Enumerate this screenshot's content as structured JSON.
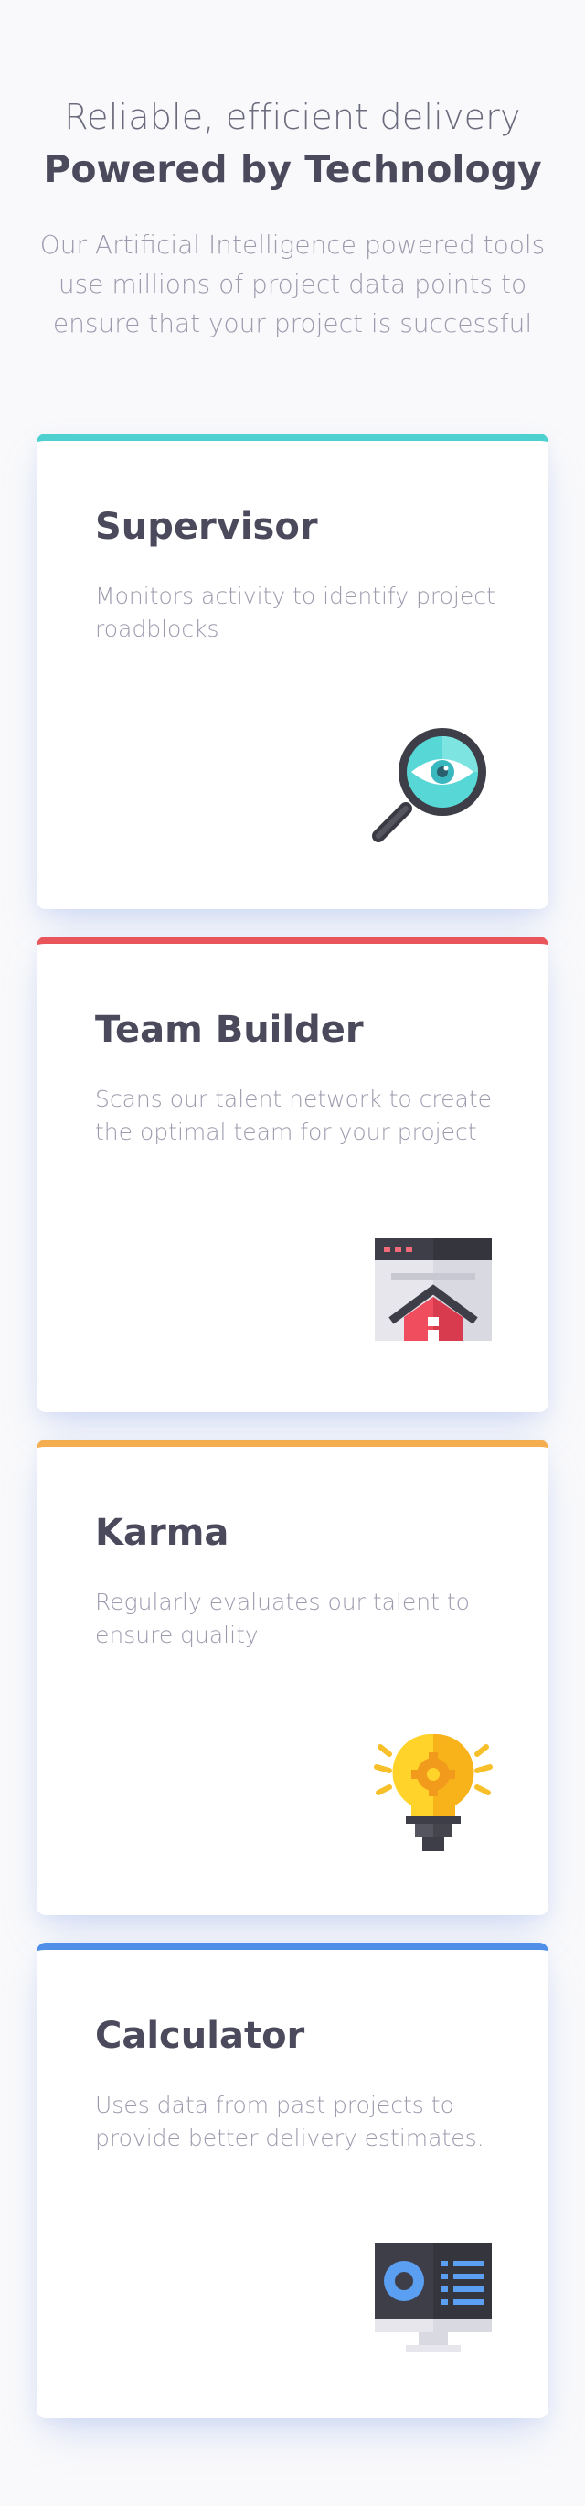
{
  "hero": {
    "eyebrow": "Reliable, efficient delivery",
    "title": "Powered by Technology",
    "subtitle": "Our Artificial Intelligence powered tools use millions of project data points to ensure that your project is successful"
  },
  "cards": [
    {
      "title": "Supervisor",
      "description": "Monitors activity to identify project roadblocks",
      "accent": "#4ecfd0",
      "icon": "magnifier-eye-icon"
    },
    {
      "title": "Team Builder",
      "description": "Scans our talent network to create the optimal team for your project",
      "accent": "#e8555a",
      "icon": "browser-home-icon"
    },
    {
      "title": "Karma",
      "description": "Regularly evaluates our talent to ensure quality",
      "accent": "#f5ae4f",
      "icon": "lightbulb-gear-icon"
    },
    {
      "title": "Calculator",
      "description": "Uses data from past projects to provide better delivery estimates.",
      "accent": "#4f8fe8",
      "icon": "monitor-dashboard-icon"
    }
  ]
}
